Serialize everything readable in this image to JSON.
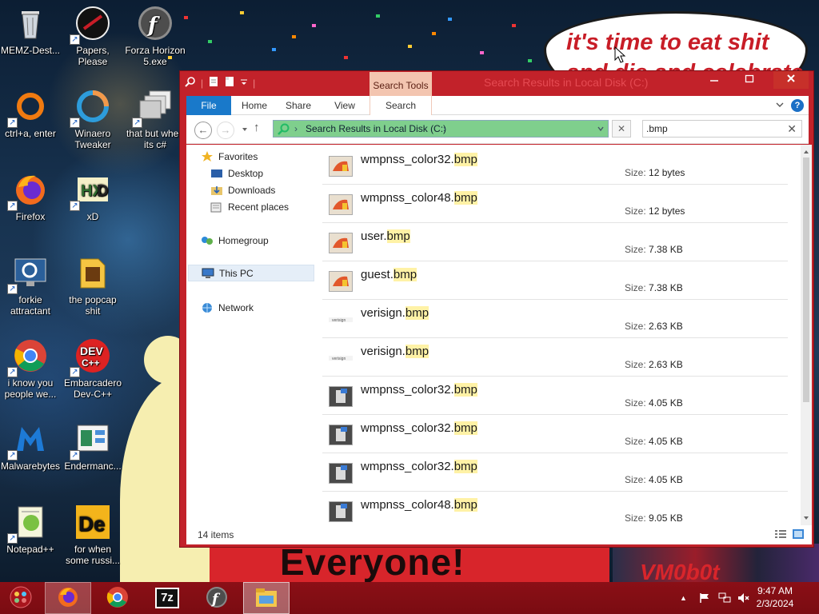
{
  "desktop": {
    "speech_text_line1": "it's time to eat shit",
    "speech_text_line2": "and die and celebrate",
    "banner_text": "Everyone!",
    "bot_text": "VM0b0t",
    "icons": [
      {
        "label": "MEMZ-Dest...",
        "icon": "recycle-bin-icon"
      },
      {
        "label": "Papers, Please",
        "icon": "papers-please-icon"
      },
      {
        "label": "Forza Horizon 5.exe",
        "icon": "flash-icon"
      },
      {
        "label": "ctrl+a, enter",
        "icon": "orange-ring-icon"
      },
      {
        "label": "Winaero Tweaker",
        "icon": "winaero-icon"
      },
      {
        "label": "that but when its c#",
        "icon": "stacked-windows-icon"
      },
      {
        "label": "Firefox",
        "icon": "firefox-icon"
      },
      {
        "label": "xD",
        "icon": "hxd-icon"
      },
      {
        "label": "forkie attractant",
        "icon": "settings-monitor-icon"
      },
      {
        "label": "the popcap shit",
        "icon": "popcap-icon"
      },
      {
        "label": "i know you people we...",
        "icon": "chrome-icon"
      },
      {
        "label": "Embarcadero Dev-C++",
        "icon": "devcpp-icon"
      },
      {
        "label": "Malwarebytes",
        "icon": "malwarebytes-icon"
      },
      {
        "label": "Endermanc...",
        "icon": "endermanch-icon"
      },
      {
        "label": "Notepad++",
        "icon": "notepadpp-icon"
      },
      {
        "label": "for when some russi...",
        "icon": "de-icon"
      }
    ]
  },
  "taskbar": {
    "start_icon": "start-orb-icon",
    "apps": [
      "firefox-icon",
      "chrome-icon",
      "7zip-icon",
      "flash-icon",
      "file-explorer-icon"
    ],
    "seven_zip_label": "7z",
    "clock_time": "9:47 AM",
    "clock_date": "2/3/2024",
    "tray_up": "▲"
  },
  "window": {
    "title": "Search Results in Local Disk (C:)",
    "contextual_tab": "Search Tools",
    "ribbon_tabs": {
      "file": "File",
      "home": "Home",
      "share": "Share",
      "view": "View",
      "search": "Search"
    },
    "help": "?",
    "address": "Search Results in Local Disk (C:)",
    "search_value": ".bmp",
    "nav": {
      "favorites": "Favorites",
      "desktop": "Desktop",
      "downloads": "Downloads",
      "recent": "Recent places",
      "homegroup": "Homegroup",
      "this_pc": "This PC",
      "network": "Network"
    },
    "size_label": "Size:",
    "ext": "bmp",
    "files": [
      {
        "base": "wmpnss_color32.",
        "size": "12 bytes",
        "thumb": "painting-icon"
      },
      {
        "base": "wmpnss_color48.",
        "size": "12 bytes",
        "thumb": "painting-icon"
      },
      {
        "base": "user.",
        "size": "7.38 KB",
        "thumb": "painting-icon"
      },
      {
        "base": "guest.",
        "size": "7.38 KB",
        "thumb": "painting-icon"
      },
      {
        "base": "verisign.",
        "size": "2.63 KB",
        "thumb": "verisign-icon"
      },
      {
        "base": "verisign.",
        "size": "2.63 KB",
        "thumb": "verisign-icon"
      },
      {
        "base": "wmpnss_color32.",
        "size": "4.05 KB",
        "thumb": "media-device-icon"
      },
      {
        "base": "wmpnss_color32.",
        "size": "4.05 KB",
        "thumb": "media-device-icon"
      },
      {
        "base": "wmpnss_color32.",
        "size": "4.05 KB",
        "thumb": "media-device-icon"
      },
      {
        "base": "wmpnss_color48.",
        "size": "9.05 KB",
        "thumb": "media-device-icon"
      }
    ],
    "status_count": "14 items"
  },
  "colors": {
    "window_frame": "#c2222a",
    "taskbar": "#8b0f16",
    "address_bar_progress": "#7fcf8d",
    "file_tab": "#1979ca",
    "search_highlight": "#fff2a6"
  }
}
